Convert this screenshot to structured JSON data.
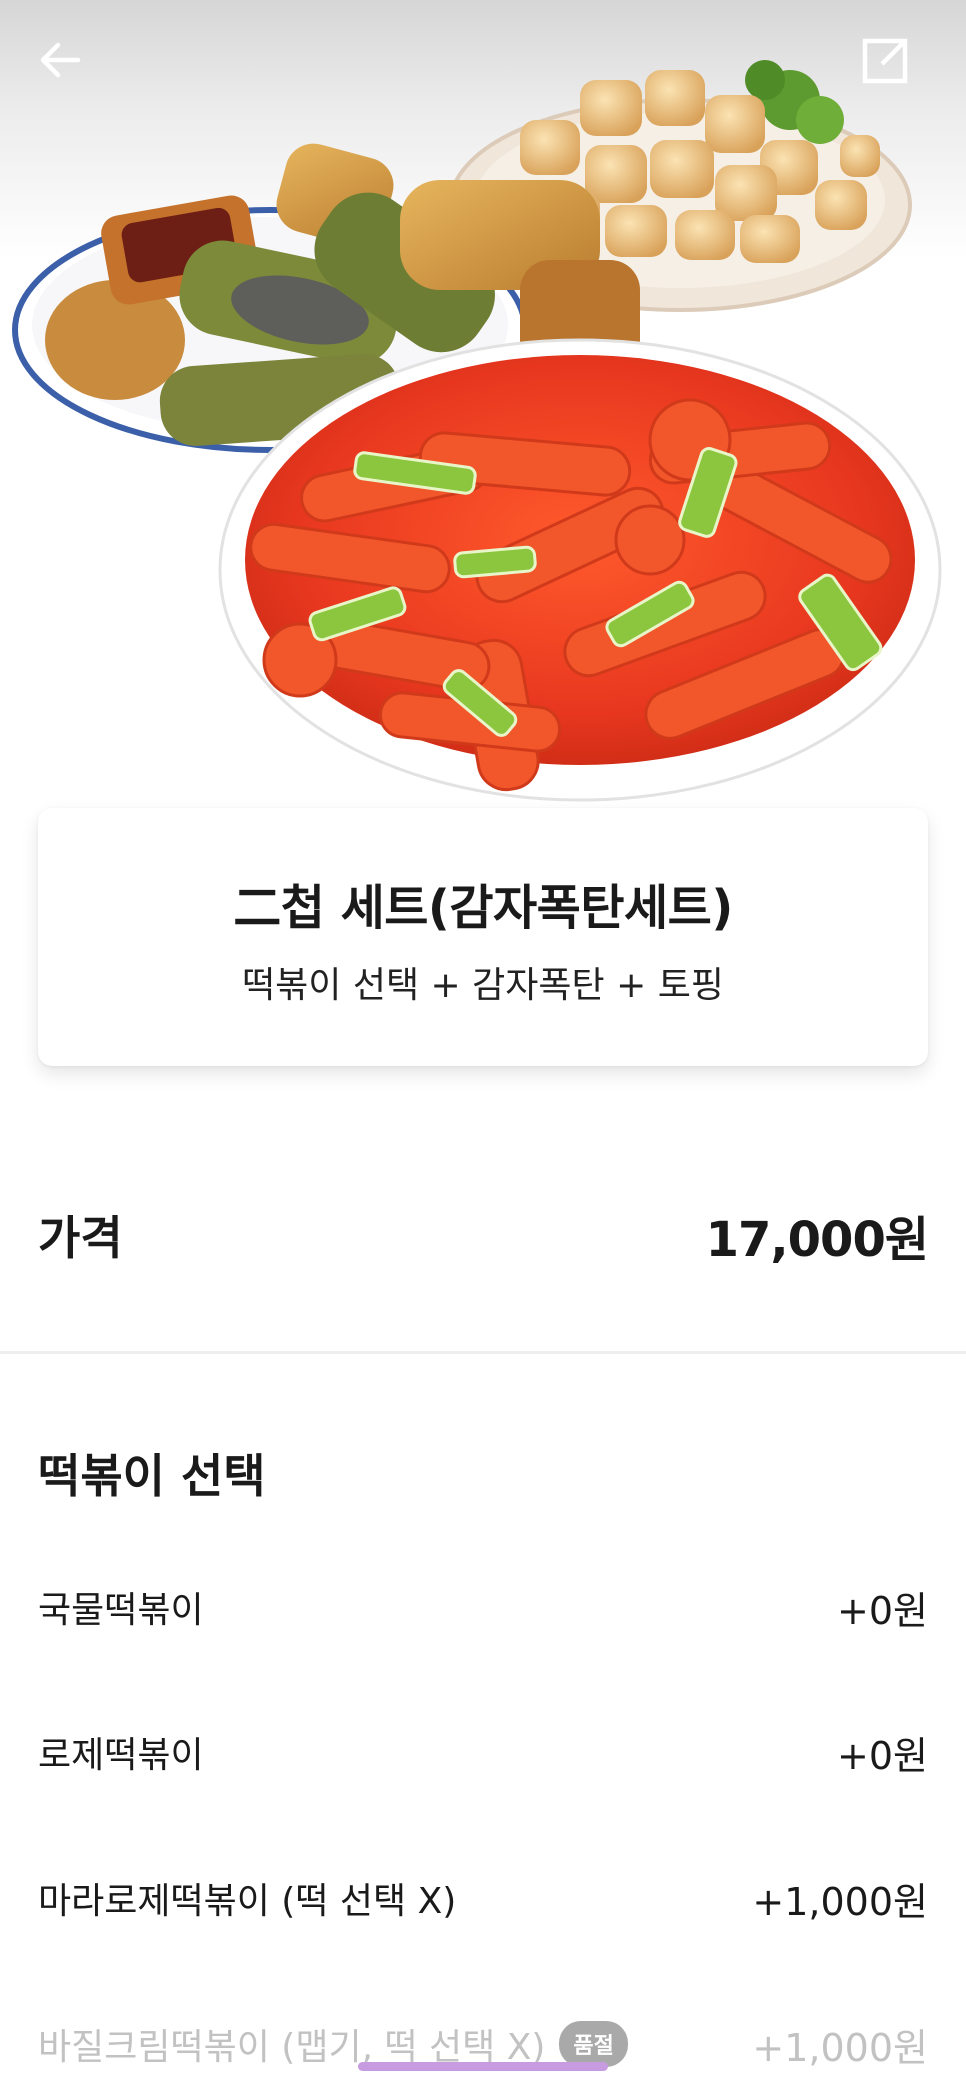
{
  "header": {
    "back_icon": "arrow-left-icon",
    "share_icon": "share-icon"
  },
  "menu": {
    "title": "二첩 세트(감자폭탄세트)",
    "description": "떡볶이 선택 + 감자폭탄 + 토핑"
  },
  "price": {
    "label": "가격",
    "value": "17,000원"
  },
  "section": {
    "title": "떡볶이 선택",
    "options": [
      {
        "name": "국물떡볶이",
        "price": "+0원",
        "soldout": false
      },
      {
        "name": "로제떡볶이",
        "price": "+0원",
        "soldout": false
      },
      {
        "name": "마라로제떡볶이 (떡 선택 X)",
        "price": "+1,000원",
        "soldout": false
      },
      {
        "name": "바질크림떡볶이 (맵기, 떡 선택 X)",
        "price": "+1,000원",
        "soldout": true,
        "badge": "품절"
      }
    ]
  },
  "colors": {
    "accent_bar": "#c69be0",
    "sauce_red": "#e8371f",
    "soldout_gray": "#c2c2c2"
  }
}
